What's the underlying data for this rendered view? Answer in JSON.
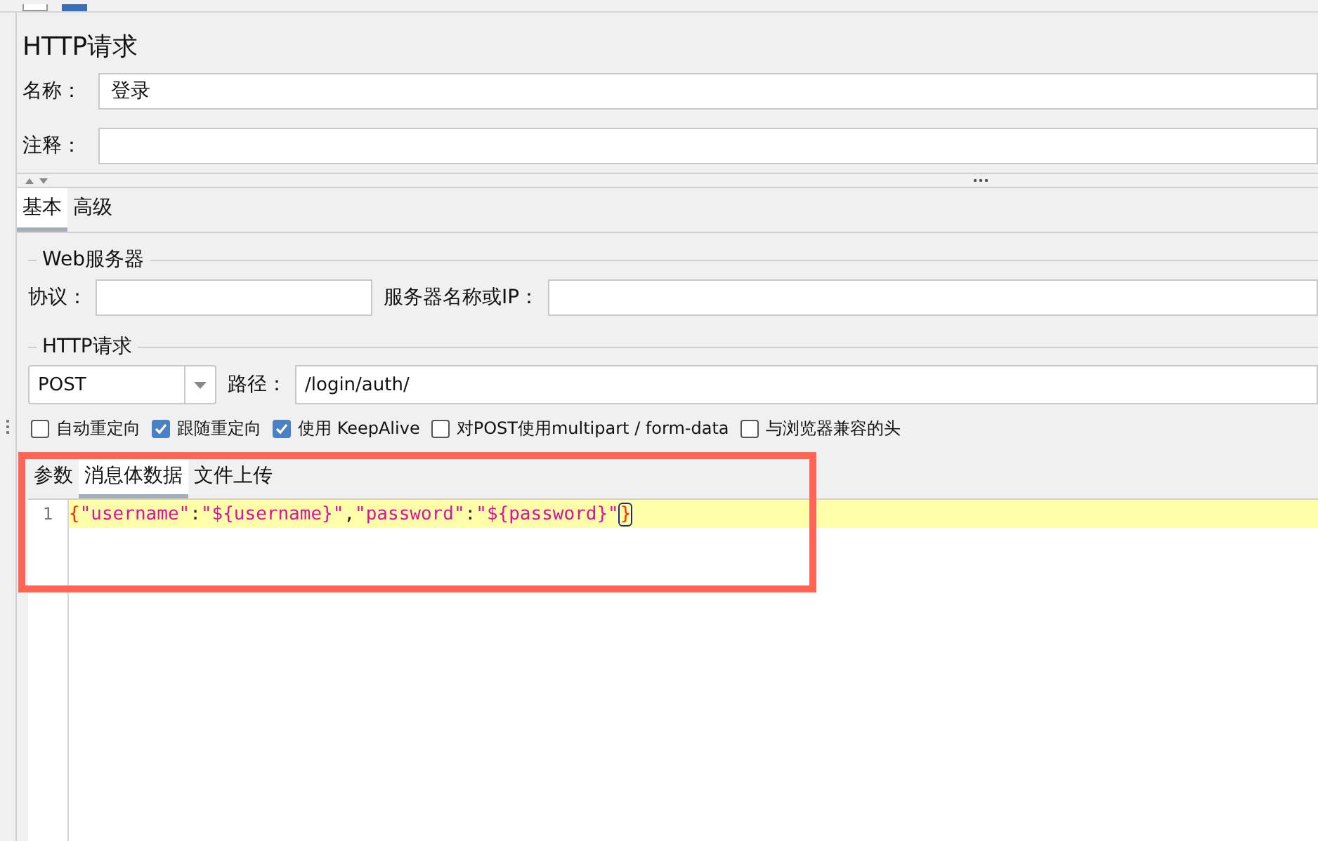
{
  "title": "HTTP请求",
  "fields": [
    {
      "label": "名称：",
      "value": "登录"
    },
    {
      "label": "注释："
    }
  ],
  "tabs": [
    {
      "label": "基本",
      "selected": true
    },
    {
      "label": "高级",
      "selected": false
    }
  ],
  "web_server": {
    "legend": "Web服务器",
    "protocol_label": "协议：",
    "server_label": "服务器名称或IP："
  },
  "http_request": {
    "legend": "HTTP请求",
    "method": "POST",
    "path_label": "路径：",
    "path_value": "/login/auth/"
  },
  "options": [
    {
      "label": "自动重定向",
      "checked": false
    },
    {
      "label": "跟随重定向",
      "checked": true
    },
    {
      "label": "使用 KeepAlive",
      "checked": true
    },
    {
      "label": "对POST使用multipart / form-data",
      "checked": false
    },
    {
      "label": "与浏览器兼容的头",
      "checked": false
    }
  ],
  "body_tabs": [
    {
      "label": "参数",
      "selected": false
    },
    {
      "label": "消息体数据",
      "selected": true
    },
    {
      "label": "文件上传",
      "selected": false
    }
  ],
  "editor": {
    "lines": [
      {
        "number": "1",
        "current": true,
        "tokens": [
          {
            "text": "{",
            "kind": "brace"
          },
          {
            "text": "\"username\"",
            "kind": "string"
          },
          {
            "text": ":",
            "kind": "punct"
          },
          {
            "text": "\"${username}\"",
            "kind": "string"
          },
          {
            "text": ",",
            "kind": "punct"
          },
          {
            "text": "\"password\"",
            "kind": "string"
          },
          {
            "text": ":",
            "kind": "punct"
          },
          {
            "text": "\"${password}\"",
            "kind": "string"
          },
          {
            "text": "}",
            "kind": "brace-matched"
          }
        ]
      }
    ]
  },
  "highlight": {
    "color": "#ff6455"
  }
}
